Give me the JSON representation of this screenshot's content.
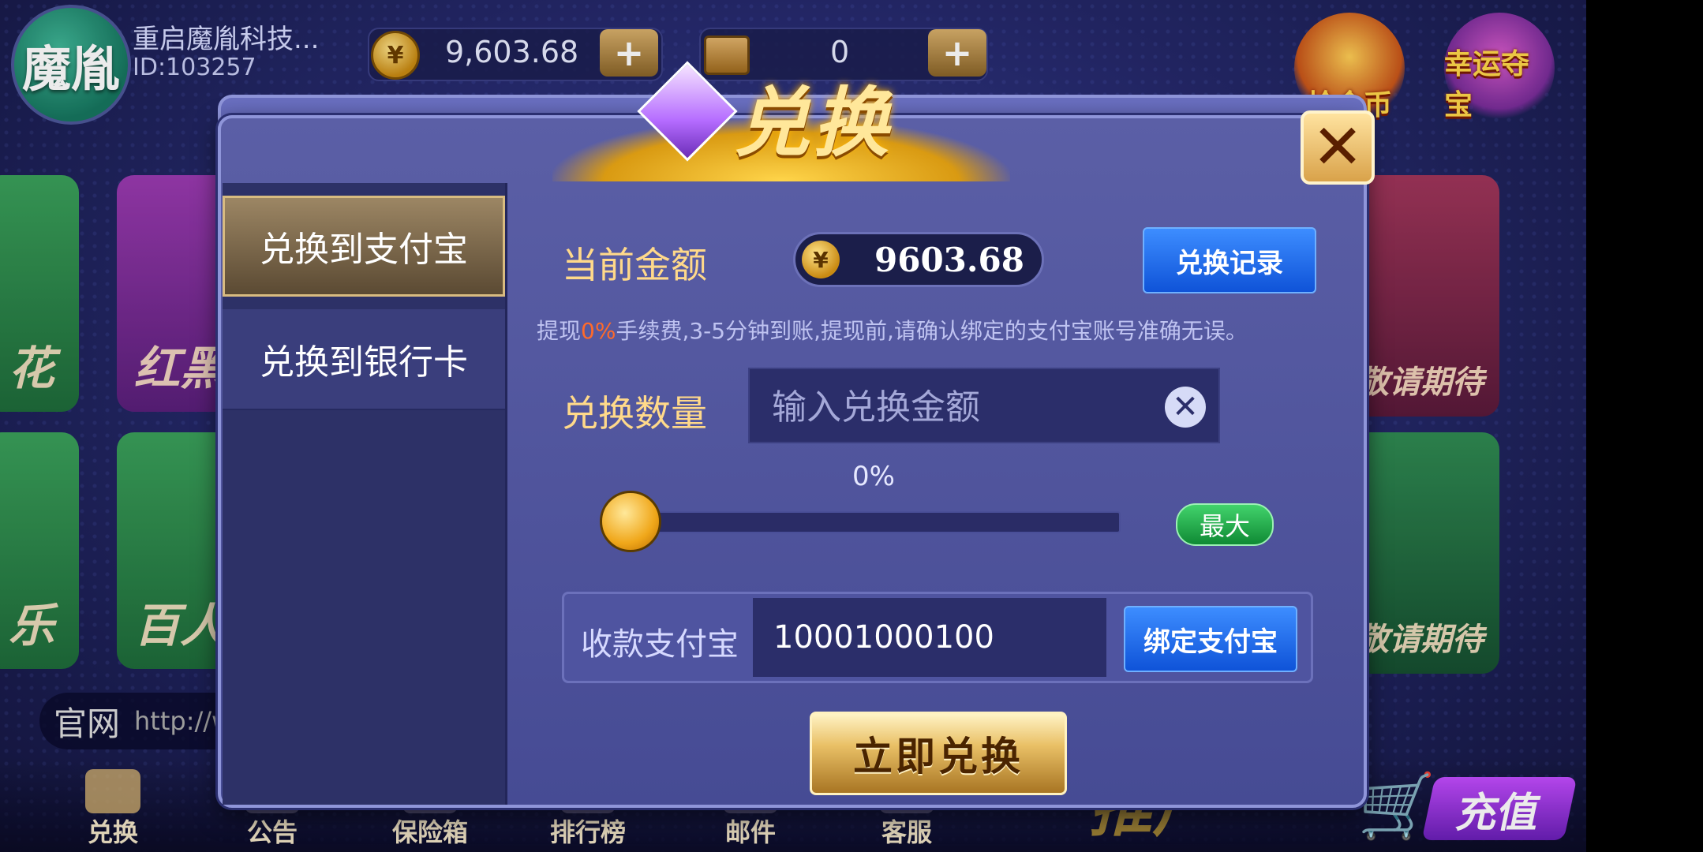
{
  "user": {
    "avatar_text": "魔胤",
    "name": "重启魔胤科技...",
    "id": "ID:103257"
  },
  "top_bar": {
    "coins": "9,603.68",
    "cards": "0",
    "plus": "+"
  },
  "corner_icons": {
    "grab_gold": "抢金币",
    "lucky_treasure": "幸运夺宝"
  },
  "background_tiles": {
    "tile1": "花",
    "tile2": "红黑",
    "tile3": "乐",
    "tile4": "百人",
    "tile5": "敬请期待",
    "tile6": "敬请期待"
  },
  "official_site": {
    "label": "官网",
    "url": "http://w"
  },
  "bottom_nav": {
    "items": [
      "兑换",
      "公告",
      "保险箱",
      "排行榜",
      "邮件",
      "客服"
    ],
    "promote": "推广",
    "recharge": "充值"
  },
  "dialog": {
    "title": "兑换",
    "close": "✕",
    "tabs": [
      "兑换到支付宝",
      "兑换到银行卡"
    ],
    "current_amount_label": "当前金额",
    "current_amount_symbol": "¥",
    "current_amount_value": "9603.68",
    "history_button": "兑换记录",
    "hint_prefix": "提现",
    "hint_highlight": "0%",
    "hint_suffix": "手续费,3-5分钟到账,提现前,请确认绑定的支付宝账号准确无误。",
    "quantity_label": "兑换数量",
    "quantity_placeholder": "输入兑换金额",
    "quantity_value": "",
    "clear": "✕",
    "slider_percent_text": "0%",
    "slider_fraction": 0,
    "max_button": "最大",
    "alipay_label": "收款支付宝",
    "alipay_account": "10001000100",
    "bind_button": "绑定支付宝",
    "submit_button": "立即兑换"
  },
  "colors": {
    "accent_gold": "#ffd98a",
    "button_blue": "#1f6cf0",
    "button_green": "#1fa84a",
    "hint_highlight": "#ff6a2a"
  }
}
